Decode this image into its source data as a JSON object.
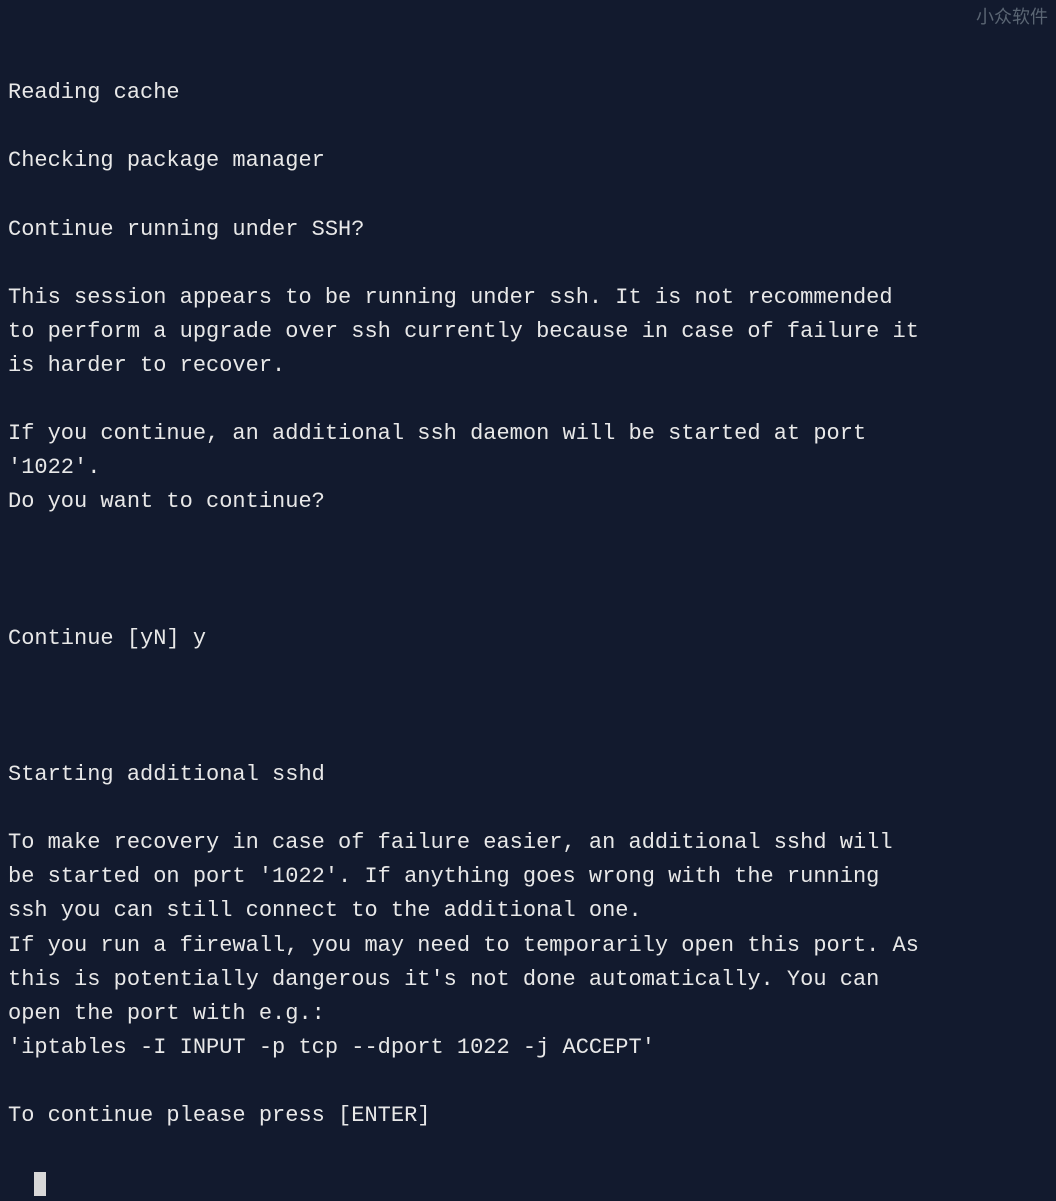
{
  "watermark": "小众软件",
  "terminal": {
    "lines": [
      "Reading cache",
      "",
      "Checking package manager",
      "",
      "Continue running under SSH?",
      "",
      "This session appears to be running under ssh. It is not recommended",
      "to perform a upgrade over ssh currently because in case of failure it",
      "is harder to recover.",
      "",
      "If you continue, an additional ssh daemon will be started at port",
      "'1022'.",
      "Do you want to continue?",
      ""
    ],
    "prompt": "Continue [yN] ",
    "prompt_response": "y",
    "lines_after": [
      "",
      "Starting additional sshd",
      "",
      "To make recovery in case of failure easier, an additional sshd will",
      "be started on port '1022'. If anything goes wrong with the running",
      "ssh you can still connect to the additional one.",
      "If you run a firewall, you may need to temporarily open this port. As",
      "this is potentially dangerous it's not done automatically. You can",
      "open the port with e.g.:",
      "'iptables -I INPUT -p tcp --dport 1022 -j ACCEPT'",
      "",
      "To continue please press [ENTER]"
    ]
  }
}
